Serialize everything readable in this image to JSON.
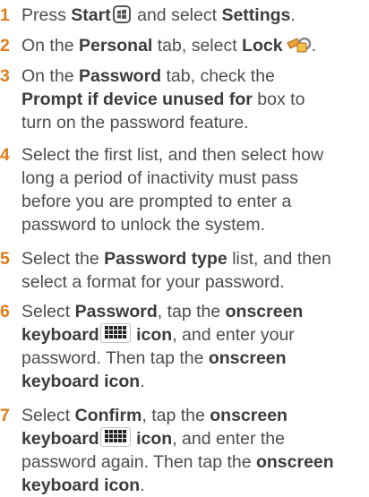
{
  "steps": [
    {
      "num": "1",
      "lines": [
        [
          {
            "t": "Press "
          },
          {
            "b": "Start"
          },
          {
            "icon": "start-icon"
          },
          {
            "t": " and select "
          },
          {
            "b": "Settings"
          },
          {
            "t": "."
          }
        ]
      ]
    },
    {
      "num": "2",
      "lines": [
        [
          {
            "t": "On the "
          },
          {
            "b": "Personal"
          },
          {
            "t": " tab, select "
          },
          {
            "b": "Lock"
          },
          {
            "icon": "lock-icon"
          },
          {
            "t": "."
          }
        ]
      ]
    },
    {
      "num": "3",
      "lines": [
        [
          {
            "t": "On the "
          },
          {
            "b": "Password"
          },
          {
            "t": " tab, check the"
          }
        ],
        [
          {
            "b": "Prompt if device unused for"
          },
          {
            "t": " box to"
          }
        ],
        [
          {
            "t": "turn on the password feature."
          }
        ]
      ]
    },
    {
      "num": "4",
      "lines": [
        [
          {
            "t": "Select the first list, and then select how"
          }
        ],
        [
          {
            "t": "long a period of inactivity must pass"
          }
        ],
        [
          {
            "t": "before you are prompted to enter a"
          }
        ],
        [
          {
            "t": "password to unlock the system."
          }
        ]
      ]
    },
    {
      "num": "5",
      "lines": [
        [
          {
            "t": "Select the "
          },
          {
            "b": "Password type"
          },
          {
            "t": " list, and then"
          }
        ],
        [
          {
            "t": "select a format for your password."
          }
        ]
      ]
    },
    {
      "num": "6",
      "lines": [
        [
          {
            "t": "Select "
          },
          {
            "b": "Password"
          },
          {
            "t": ", tap the "
          },
          {
            "b": "onscreen"
          }
        ],
        [
          {
            "b": "keyboard"
          },
          {
            "icon": "keyboard-icon"
          },
          {
            "b": " icon"
          },
          {
            "t": ", and enter your"
          }
        ],
        [
          {
            "t": "password. Then tap the "
          },
          {
            "b": "onscreen"
          }
        ],
        [
          {
            "b": "keyboard icon"
          },
          {
            "t": "."
          }
        ]
      ]
    },
    {
      "num": "7",
      "lines": [
        [
          {
            "t": "Select "
          },
          {
            "b": "Confirm"
          },
          {
            "t": ", tap the "
          },
          {
            "b": "onscreen"
          }
        ],
        [
          {
            "b": "keyboard"
          },
          {
            "icon": "keyboard-icon"
          },
          {
            "b": " icon"
          },
          {
            "t": ", and enter the"
          }
        ],
        [
          {
            "t": "password again. Then tap the "
          },
          {
            "b": "onscreen"
          }
        ],
        [
          {
            "b": "keyboard icon"
          },
          {
            "t": "."
          }
        ]
      ]
    }
  ],
  "colors": {
    "step_number": "#e07b16",
    "body_text": "#4d4d4d",
    "lock_icon": "#e8a23a"
  }
}
